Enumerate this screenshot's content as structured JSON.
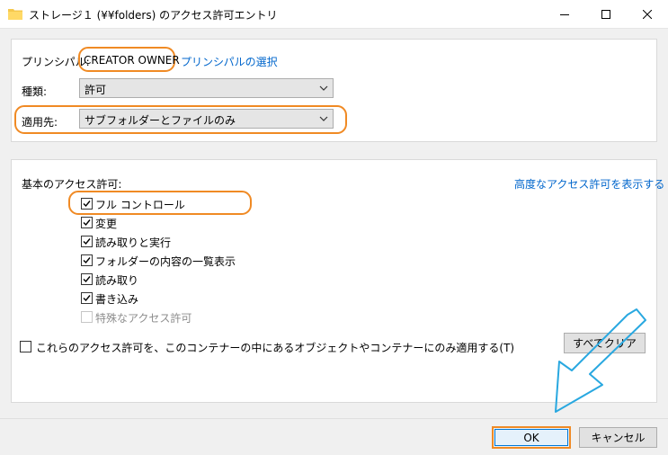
{
  "window": {
    "title": "ストレージ１ (¥¥folders) のアクセス許可エントリ",
    "icon": "folder-icon"
  },
  "principal": {
    "label": "プリンシパル:",
    "value": "CREATOR OWNER",
    "select_link": "プリンシパルの選択"
  },
  "type": {
    "label": "種類:",
    "value": "許可"
  },
  "applies_to": {
    "label": "適用先:",
    "value": "サブフォルダーとファイルのみ"
  },
  "permissions": {
    "heading": "基本のアクセス許可:",
    "advanced_link": "高度なアクセス許可を表示する",
    "items": [
      {
        "label": "フル コントロール",
        "checked": true,
        "enabled": true
      },
      {
        "label": "変更",
        "checked": true,
        "enabled": true
      },
      {
        "label": "読み取りと実行",
        "checked": true,
        "enabled": true
      },
      {
        "label": "フォルダーの内容の一覧表示",
        "checked": true,
        "enabled": true
      },
      {
        "label": "読み取り",
        "checked": true,
        "enabled": true
      },
      {
        "label": "書き込み",
        "checked": true,
        "enabled": true
      },
      {
        "label": "特殊なアクセス許可",
        "checked": false,
        "enabled": false
      }
    ]
  },
  "apply_only": {
    "label": "これらのアクセス許可を、このコンテナーの中にあるオブジェクトやコンテナーにのみ適用する(T)",
    "checked": false
  },
  "buttons": {
    "clear_all": "すべてクリア",
    "ok": "OK",
    "cancel": "キャンセル"
  },
  "colors": {
    "highlight": "#f08a24",
    "arrow": "#29a8e0",
    "link": "#0066cc"
  }
}
